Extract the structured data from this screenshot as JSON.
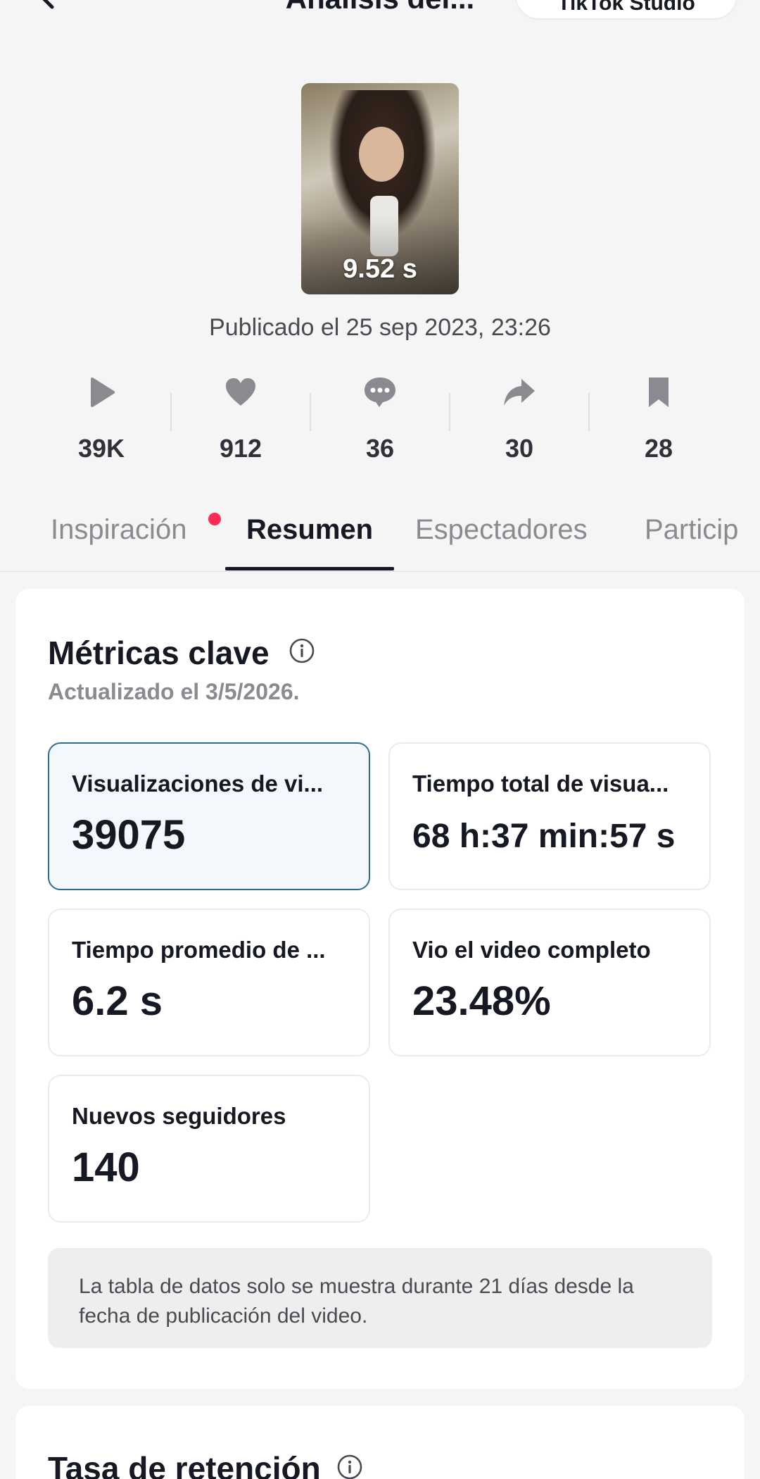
{
  "header": {
    "title": "Análisis del...",
    "studio_button": "TikTok Studio"
  },
  "video": {
    "duration": "9.52 s",
    "published": "Publicado el 25 sep 2023, 23:26"
  },
  "stats": [
    {
      "icon": "play-icon",
      "value": "39K"
    },
    {
      "icon": "heart-icon",
      "value": "912"
    },
    {
      "icon": "comment-icon",
      "value": "36"
    },
    {
      "icon": "share-icon",
      "value": "30"
    },
    {
      "icon": "bookmark-icon",
      "value": "28"
    }
  ],
  "tabs": [
    {
      "label": "Inspiración",
      "has_dot": true
    },
    {
      "label": "Resumen",
      "active": true
    },
    {
      "label": "Espectadores"
    },
    {
      "label": "Particip"
    }
  ],
  "key_metrics": {
    "title": "Métricas clave",
    "updated": "Actualizado el 3/5/2026.",
    "items": [
      {
        "label": "Visualizaciones de vi...",
        "value": "39075",
        "selected": true
      },
      {
        "label": "Tiempo total de visua...",
        "value": "68 h:37 min:57 s"
      },
      {
        "label": "Tiempo promedio de ...",
        "value": "6.2 s"
      },
      {
        "label": "Vio el video completo",
        "value": "23.48%"
      },
      {
        "label": "Nuevos seguidores",
        "value": "140"
      }
    ],
    "notice": "La tabla de datos solo se muestra durante 21 días desde la fecha de publicación del video."
  },
  "retention": {
    "title": "Tasa de retención"
  },
  "colors": {
    "accent_dot": "#fe2c55",
    "selected_border": "#2d6e8f",
    "selected_bg": "#f2f8fc",
    "text_primary": "#161823",
    "text_secondary": "#8a8b91"
  }
}
